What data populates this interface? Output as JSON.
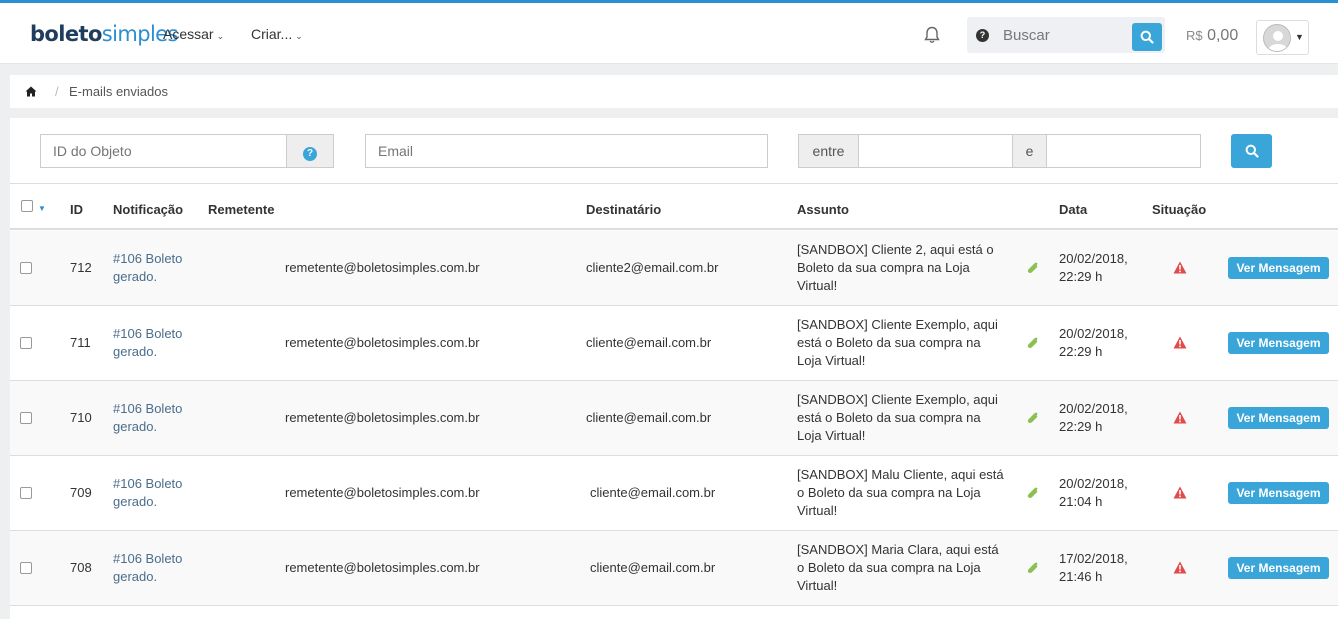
{
  "nav": {
    "logo_bold": "boleto",
    "logo_light": "simples",
    "menu": [
      {
        "label": "Acessar"
      },
      {
        "label": "Criar..."
      }
    ],
    "search_placeholder": "Buscar",
    "balance_currency": "R$",
    "balance_value": "0,00"
  },
  "breadcrumb": {
    "current": "E-mails enviados"
  },
  "filters": {
    "object_id_placeholder": "ID do Objeto",
    "email_placeholder": "Email",
    "between_label": "entre",
    "and_label": "e"
  },
  "table": {
    "headers": {
      "id": "ID",
      "notification": "Notificação",
      "sender": "Remetente",
      "recipient": "Destinatário",
      "subject": "Assunto",
      "date": "Data",
      "status": "Situação"
    },
    "action_label": "Ver Mensagem",
    "rows": [
      {
        "id": "712",
        "notification_line1": "#106 Boleto",
        "notification_line2": "gerado.",
        "sender": "remetente@boletosimples.com.br",
        "recipient": "cliente2@email.com.br",
        "subject_line1": "[SANDBOX] Cliente 2, aqui está o",
        "subject_line2": "Boleto da sua compra na Loja",
        "subject_line3": "Virtual!",
        "date_line1": "20/02/2018,",
        "date_line2": "22:29 h"
      },
      {
        "id": "711",
        "notification_line1": "#106 Boleto",
        "notification_line2": "gerado.",
        "sender": "remetente@boletosimples.com.br",
        "recipient": "cliente@email.com.br",
        "subject_line1": "[SANDBOX] Cliente Exemplo, aqui",
        "subject_line2": "está o Boleto da sua compra na",
        "subject_line3": "Loja Virtual!",
        "date_line1": "20/02/2018,",
        "date_line2": "22:29 h"
      },
      {
        "id": "710",
        "notification_line1": "#106 Boleto",
        "notification_line2": "gerado.",
        "sender": "remetente@boletosimples.com.br",
        "recipient": "cliente@email.com.br",
        "subject_line1": "[SANDBOX] Cliente Exemplo, aqui",
        "subject_line2": "está o Boleto da sua compra na",
        "subject_line3": "Loja Virtual!",
        "date_line1": "20/02/2018,",
        "date_line2": "22:29 h"
      },
      {
        "id": "709",
        "notification_line1": "#106 Boleto",
        "notification_line2": "gerado.",
        "sender": "remetente@boletosimples.com.br",
        "recipient": "cliente@email.com.br",
        "subject_line1": "[SANDBOX] Malu Cliente, aqui está",
        "subject_line2": "o Boleto da sua compra na Loja",
        "subject_line3": "Virtual!",
        "date_line1": "20/02/2018,",
        "date_line2": "21:04 h"
      },
      {
        "id": "708",
        "notification_line1": "#106 Boleto",
        "notification_line2": "gerado.",
        "sender": "remetente@boletosimples.com.br",
        "recipient": "cliente@email.com.br",
        "subject_line1": "[SANDBOX] Maria Clara, aqui está",
        "subject_line2": "o Boleto da sua compra na Loja",
        "subject_line3": "Virtual!",
        "date_line1": "17/02/2018,",
        "date_line2": "21:46 h"
      }
    ]
  },
  "colors": {
    "accent": "#3aa5d9",
    "link": "#4a6d8c",
    "warning": "#e04b4b",
    "attachment": "#8cc152"
  },
  "icons": [
    "bell-icon",
    "question-circle-icon",
    "search-icon",
    "home-icon",
    "paperclip-icon",
    "warning-icon",
    "user-avatar-icon"
  ]
}
